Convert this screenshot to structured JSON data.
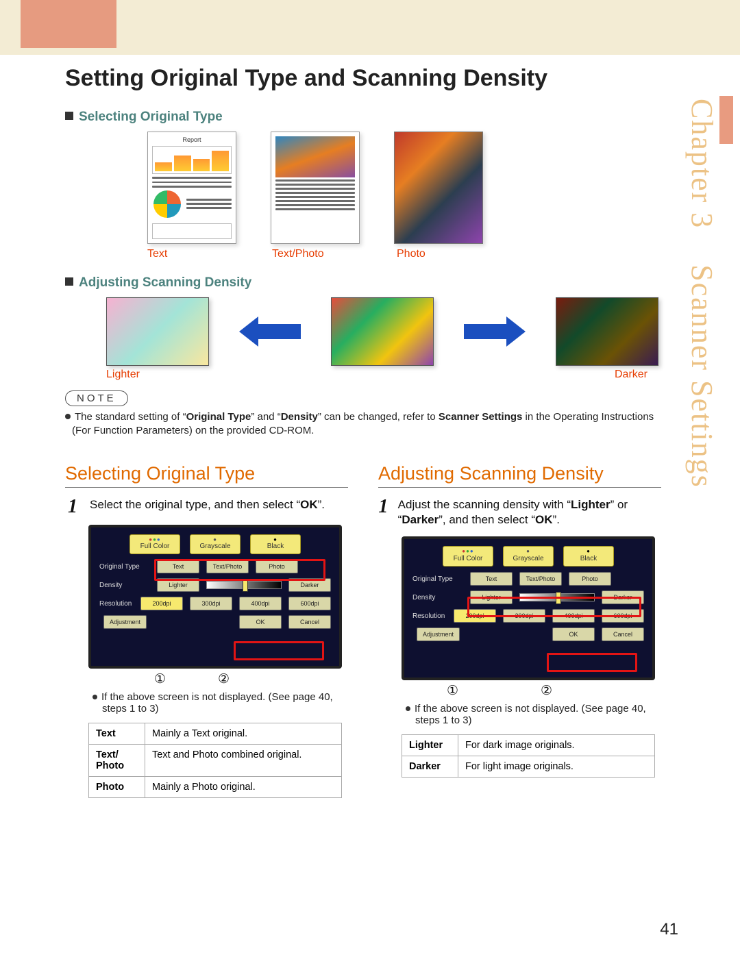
{
  "side": {
    "chapter_word": "Chapter",
    "chapter_num": "3",
    "section": "Scanner Settings"
  },
  "page_title": "Setting Original Type and Scanning Density",
  "sec1": {
    "heading": "Selecting Original Type"
  },
  "type_labels": {
    "text": "Text",
    "textphoto": "Text/Photo",
    "photo": "Photo"
  },
  "docthumb": {
    "title": "Report"
  },
  "sec2": {
    "heading": "Adjusting Scanning Density"
  },
  "dens_labels": {
    "lighter": "Lighter",
    "darker": "Darker"
  },
  "note": {
    "pill": "NOTE",
    "line_full": "The standard setting of “Original Type” and “Density” can be changed, refer to Scanner Settings in the Operating Instructions (For Function Parameters) on the provided CD-ROM.",
    "pre": "The standard setting of “",
    "b1": "Original Type",
    "mid": "” and “",
    "b2": "Density",
    "aft": "” can be changed, refer to ",
    "b3": "Scanner Settings",
    "tail": " in the Operating Instructions (For Function Parameters) on the provided CD-ROM."
  },
  "colA": {
    "heading": "Selecting Original Type",
    "step1_pre": "Select the original type, and then select “",
    "step1_ok": "OK",
    "step1_post": "”.",
    "sub": "If the above screen is not displayed. (See page 40, steps 1 to 3)",
    "circ1": "①",
    "circ2": "②",
    "table": [
      {
        "k": "Text",
        "v": "Mainly a Text original."
      },
      {
        "k": "Text/ Photo",
        "v": "Text and Photo combined original."
      },
      {
        "k": "Photo",
        "v": "Mainly a Photo original."
      }
    ]
  },
  "colB": {
    "heading": "Adjusting Scanning Density",
    "step1_pre": "Adjust the scanning density with “",
    "step1_b1": "Lighter",
    "step1_mid": "” or “",
    "step1_b2": "Darker",
    "step1_post1": "”, and then select “",
    "step1_ok": "OK",
    "step1_post2": "”.",
    "sub": "If the above screen is not displayed. (See page 40, steps 1 to 3)",
    "circ1": "①",
    "circ2": "②",
    "table": [
      {
        "k": "Lighter",
        "v": "For dark image originals."
      },
      {
        "k": "Darker",
        "v": "For light image originals."
      }
    ]
  },
  "screen": {
    "tabs": {
      "full": "Full Color",
      "gray": "Grayscale",
      "black": "Black"
    },
    "rows": {
      "type": "Original Type",
      "density": "Density",
      "res": "Resolution",
      "adj": "Adjustment"
    },
    "btns": {
      "text": "Text",
      "tp": "Text/Photo",
      "photo": "Photo",
      "lighter": "Lighter",
      "darker": "Darker",
      "r200": "200dpi",
      "r300": "300dpi",
      "r400": "400dpi",
      "r600": "600dpi",
      "ok": "OK",
      "cancel": "Cancel"
    }
  },
  "page_number": "41"
}
